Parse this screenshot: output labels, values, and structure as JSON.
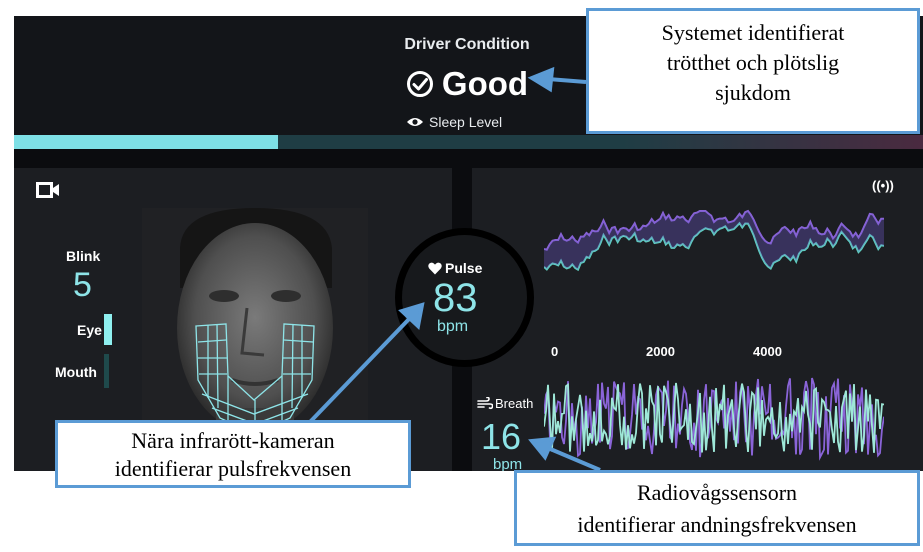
{
  "driver": {
    "label": "Driver Condition",
    "value": "Good",
    "sleep_label": "Sleep Level",
    "sleep_level": 0.29
  },
  "vitals": {
    "blink_label": "Blink",
    "blink_value": "5",
    "eye_label": "Eye",
    "mouth_label": "Mouth",
    "pulse_label": "Pulse",
    "pulse_value": "83",
    "pulse_unit": "bpm",
    "breath_label": "Breath",
    "breath_value": "16",
    "breath_unit": "bpm"
  },
  "chart": {
    "ticks": [
      "0",
      "2000",
      "4000"
    ]
  },
  "callouts": {
    "top": [
      "Systemet identifierat",
      "trötthet och plötslig",
      "sjukdom"
    ],
    "left": [
      "Nära infrarött-kameran",
      "identifierar pulsfrekvensen"
    ],
    "right": [
      "Radiovågssensorn",
      "identifierar andningsfrekvensen"
    ]
  },
  "colors": {
    "accent": "#8ee4e8",
    "wave_purple": "#8a64d8",
    "wave_teal": "#5fd0c0",
    "callout_border": "#5b9bd5"
  },
  "icons": [
    "camera-icon",
    "radio-signal-icon",
    "check-circle-icon",
    "eye-icon",
    "heart-icon",
    "wind-icon"
  ]
}
